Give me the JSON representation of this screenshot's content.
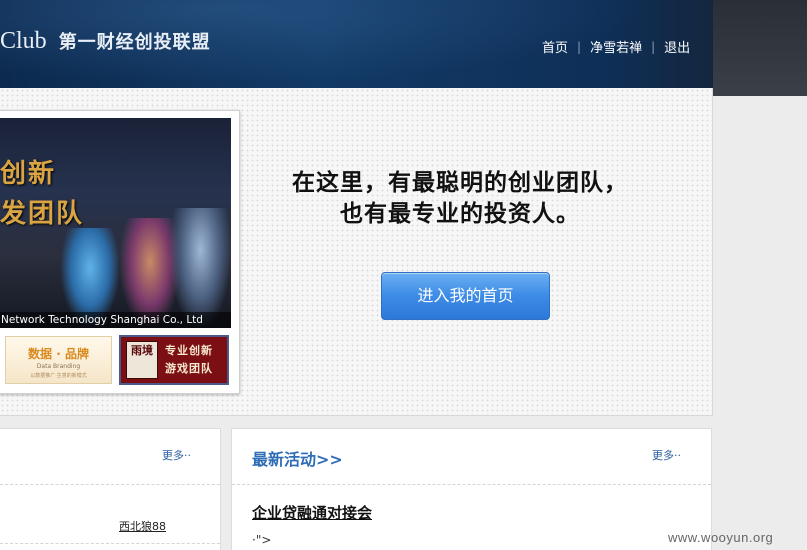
{
  "header": {
    "logo_prefix": "Club",
    "logo_name": "第一财经创投联盟",
    "nav": [
      "首页",
      "净雪若禅",
      "退出"
    ],
    "nav_separator": "|"
  },
  "hero": {
    "slide": {
      "title_line1": "创新",
      "title_line2": "发团队",
      "caption": "Network Technology Shanghai Co., Ltd"
    },
    "thumb1": {
      "title": "数据 · 品牌",
      "sub": "Data    Branding",
      "tiny": "以数据推广·生意的新模式"
    },
    "thumb2": {
      "seal": "雨境",
      "line1": "专业创新",
      "line2": "游戏团队"
    },
    "slogan_line1": "在这里，有最聪明的创业团队，",
    "slogan_line2": "也有最专业的投资人。",
    "cta_label": "进入我的首页"
  },
  "left_panel": {
    "more": "更多··",
    "user": "西北狼88"
  },
  "right_panel": {
    "title": "最新活动>>",
    "more": "更多··",
    "event_title": "企业贷融通对接会",
    "snippet": "·\">"
  },
  "watermark": "www.wooyun.org",
  "colors": {
    "header_bg": "#0c2a4e",
    "cta_blue": "#3d8ce6",
    "link_blue": "#2f6db6"
  }
}
